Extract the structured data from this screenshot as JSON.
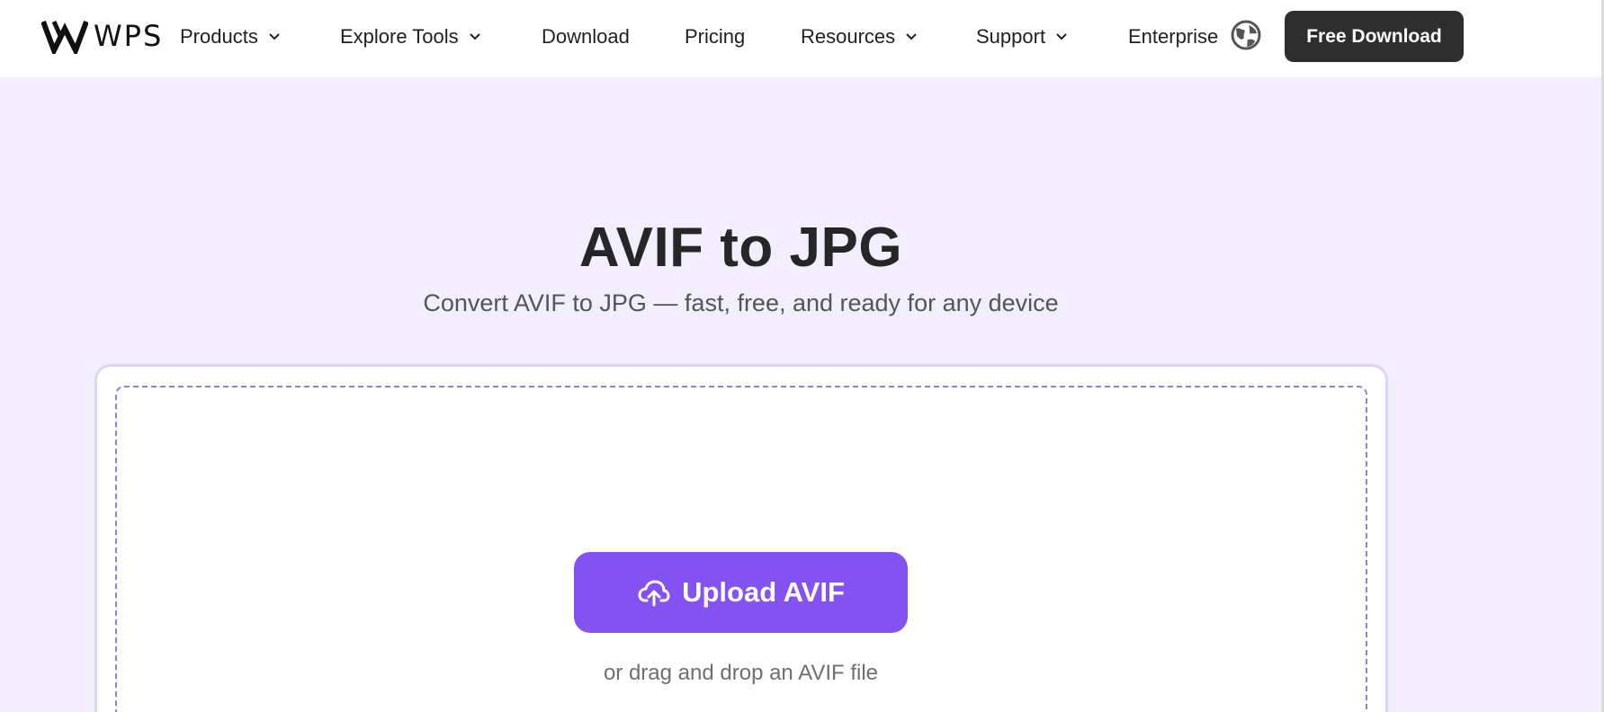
{
  "header": {
    "logo_text": "WPS",
    "nav": [
      {
        "label": "Products",
        "has_dropdown": true
      },
      {
        "label": "Explore Tools",
        "has_dropdown": true
      },
      {
        "label": "Download",
        "has_dropdown": false
      },
      {
        "label": "Pricing",
        "has_dropdown": false
      },
      {
        "label": "Resources",
        "has_dropdown": true
      },
      {
        "label": "Support",
        "has_dropdown": true
      },
      {
        "label": "Enterprise",
        "has_dropdown": false
      }
    ],
    "language_icon": "globe-icon",
    "cta_label": "Free Download"
  },
  "hero": {
    "title": "AVIF to JPG",
    "subtitle": "Convert AVIF to JPG — fast, free, and ready for any device",
    "upload_label": "Upload AVIF",
    "upload_icon": "cloud-upload-icon",
    "drop_hint": "or drag and drop an AVIF file"
  },
  "colors": {
    "hero_background": "#f2eefd",
    "primary_button": "#8452f0",
    "cta_button": "#2e2e2e",
    "dropzone_border": "#8b84d6"
  }
}
